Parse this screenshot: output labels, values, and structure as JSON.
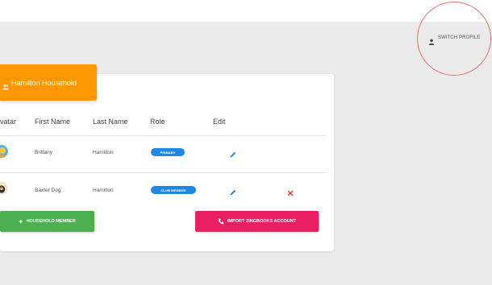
{
  "top_bar": {
    "switch_profile_label": "SWITCH PROFILE"
  },
  "household": {
    "title": "Hamilton Household",
    "columns": [
      "vatar",
      "First Name",
      "Last Name",
      "Role",
      "Edit"
    ],
    "members": [
      {
        "first_name": "Brittany",
        "last_name": "Hamilton",
        "role": "PRIMARY"
      },
      {
        "first_name": "Baxter Dog",
        "last_name": "Hamilton",
        "role": "CLUB MEMBER"
      }
    ],
    "add_member_label": "HOUSEHOLD MEMBER",
    "add_member_icon": "+",
    "import_label": "IMPORT ZINGBOOKS ACCOUNT"
  },
  "colors": {
    "header": "#ff9800",
    "badge": "#1e88e5",
    "add_button": "#4caf50",
    "import_button": "#e91e63",
    "delete_icon": "#e53935",
    "highlight_circle": "#ef6a6a"
  },
  "icons": {
    "profile": "person-icon",
    "household": "group-icon",
    "edit": "pencil-icon",
    "delete": "close-icon",
    "import": "phone-icon"
  }
}
